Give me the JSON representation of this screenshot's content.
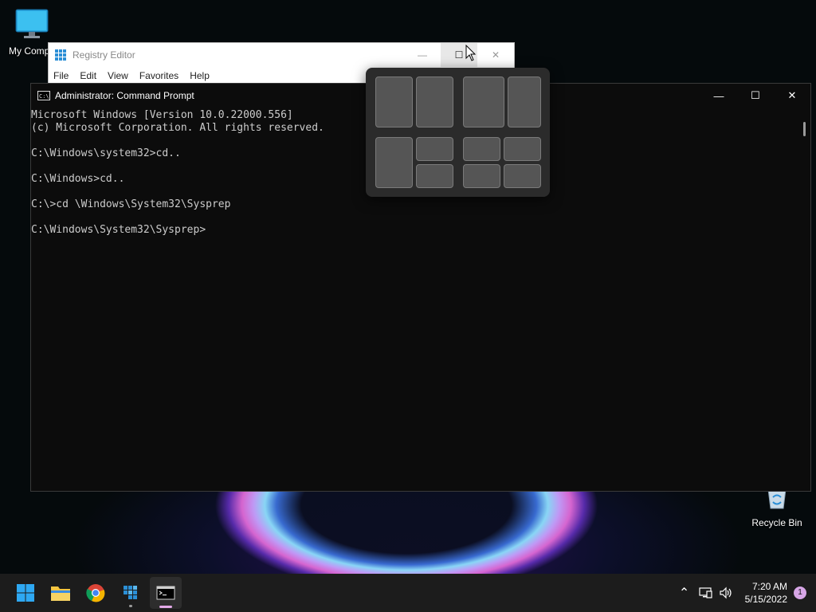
{
  "desktop": {
    "icons": [
      {
        "label": "My Compu",
        "icon": "monitor-icon"
      },
      {
        "label": "Recycle Bin",
        "icon": "recycle-bin-icon"
      }
    ]
  },
  "regedit": {
    "title": "Registry Editor",
    "menu": [
      "File",
      "Edit",
      "View",
      "Favorites",
      "Help"
    ],
    "minimize_glyph": "—",
    "maximize_glyph": "☐",
    "close_glyph": "✕"
  },
  "cmd": {
    "title": "Administrator: Command Prompt",
    "icon_text": "C:\\",
    "minimize_glyph": "—",
    "maximize_glyph": "☐",
    "close_glyph": "✕",
    "lines": [
      "Microsoft Windows [Version 10.0.22000.556]",
      "(c) Microsoft Corporation. All rights reserved.",
      "",
      "C:\\Windows\\system32>cd..",
      "",
      "C:\\Windows>cd..",
      "",
      "C:\\>cd \\Windows\\System32\\Sysprep",
      "",
      "C:\\Windows\\System32\\Sysprep>"
    ]
  },
  "snap_layouts": {
    "layouts": [
      "two-equal-columns",
      "wide-narrow-columns",
      "one-left-two-right",
      "four-quadrants"
    ]
  },
  "taskbar": {
    "apps": [
      "start",
      "file-explorer",
      "chrome",
      "registry-editor",
      "command-prompt"
    ],
    "tray_up_glyph": "⌃",
    "time": "7:20 AM",
    "date": "5/15/2022",
    "notification_count": "1"
  },
  "colors": {
    "accent": "#0078d4",
    "snap_bg": "#2b2b2b",
    "snap_zone": "#555555",
    "notif_badge": "#d7a6e6"
  }
}
